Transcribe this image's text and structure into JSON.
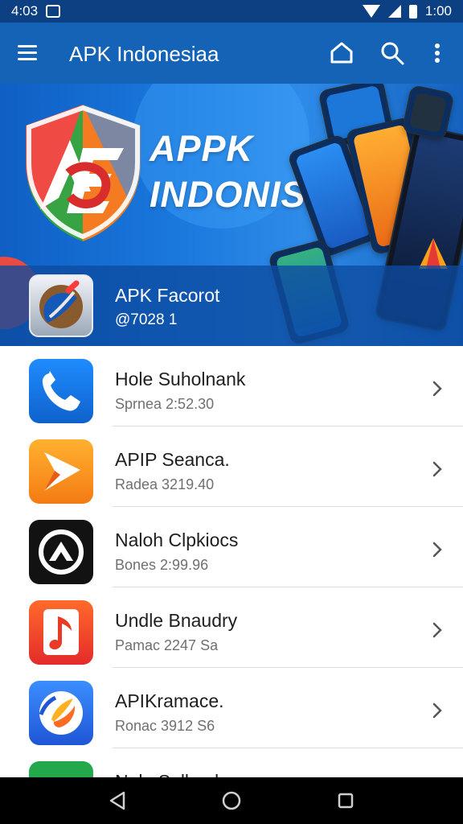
{
  "status_bar": {
    "time_left": "4:03",
    "time_right": "1:00"
  },
  "app_bar": {
    "title": "APK Indonesiaa",
    "icons": [
      "menu-icon",
      "home-icon",
      "search-icon",
      "more-vert-icon"
    ]
  },
  "hero": {
    "title_line1": "APPK",
    "title_line2": "INDONISIA",
    "featured_title": "APK Facorot",
    "featured_subtitle": "@7028 1"
  },
  "apps": [
    {
      "title": "Hole Suholnank",
      "subtitle": "Sprnea 2:52.30",
      "icon": "phone-icon",
      "icon_color": "#1877e8"
    },
    {
      "title": "APIP Seanca.",
      "subtitle": "Radea 3219.40",
      "icon": "play-icon",
      "icon_color": "#f7931e"
    },
    {
      "title": "Naloh Clpkiocs",
      "subtitle": "Bones 2:99.96",
      "icon": "mountain-logo-icon",
      "icon_color": "#111111"
    },
    {
      "title": "Undle Bnaudry",
      "subtitle": "Pamac 2247 Sa",
      "icon": "music-note-icon",
      "icon_color": "#ed3e2b"
    },
    {
      "title": "APIKramace.",
      "subtitle": "Ronac 3912 S6",
      "icon": "compass-logo-icon",
      "icon_color": "#2d6de8"
    },
    {
      "title": "Nolo Sulkaah",
      "subtitle": "",
      "icon": "green-app-icon",
      "icon_color": "#23a84b"
    }
  ],
  "colors": {
    "status_bar": "#0d3f83",
    "app_bar": "#1463b7",
    "hero": "#1b79de",
    "divider": "#dddddd",
    "nav_bar": "#000000"
  },
  "nav": {
    "icons": [
      "back-icon",
      "home-icon",
      "recent-apps-icon"
    ]
  }
}
